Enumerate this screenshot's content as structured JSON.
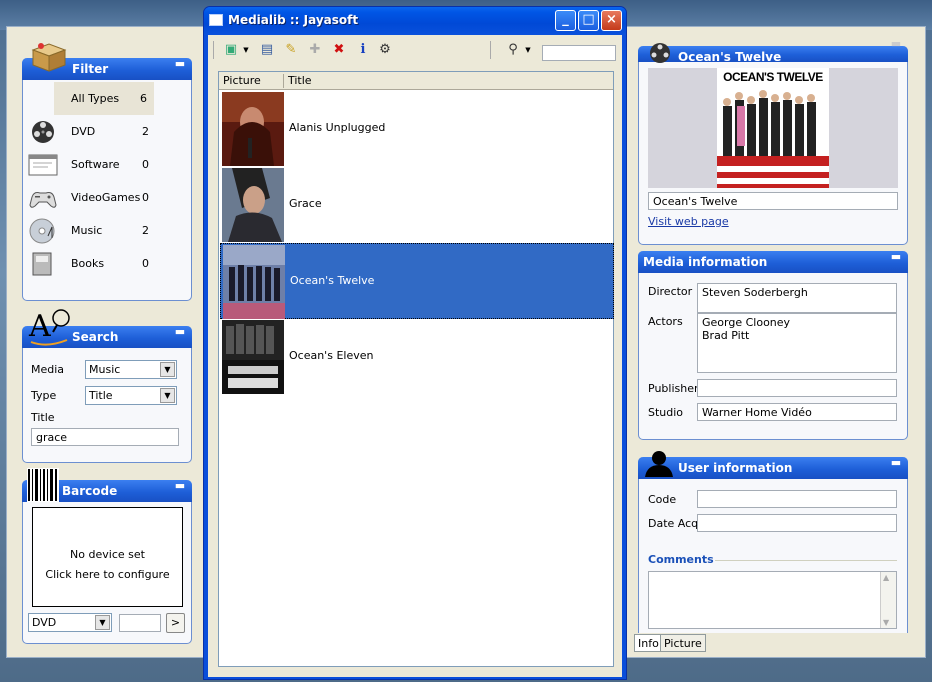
{
  "window": {
    "title": "Medialib :: Jayasoft"
  },
  "filter": {
    "title": "Filter",
    "items": [
      {
        "name": "All Types",
        "count": "6"
      },
      {
        "name": "DVD",
        "count": "2"
      },
      {
        "name": "Software",
        "count": "0"
      },
      {
        "name": "VideoGames",
        "count": "0"
      },
      {
        "name": "Music",
        "count": "2"
      },
      {
        "name": "Books",
        "count": "0"
      }
    ]
  },
  "search": {
    "title": "Search",
    "media_label": "Media",
    "media_value": "Music",
    "type_label": "Type",
    "type_value": "Title",
    "title_label": "Title",
    "title_value": "grace"
  },
  "barcode": {
    "title": "Barcode",
    "line1": "No device set",
    "line2": "Click here to configure",
    "device_value": "DVD",
    "code_value": "",
    "go_label": ">"
  },
  "list": {
    "col_picture": "Picture",
    "col_title": "Title",
    "rows": [
      {
        "title": "Alanis Unplugged"
      },
      {
        "title": "Grace"
      },
      {
        "title": "Ocean's Twelve"
      },
      {
        "title": "Ocean's Eleven"
      }
    ]
  },
  "preview": {
    "title": "Ocean's Twelve",
    "poster_text": "OCEAN'S TWELVE",
    "name_value": "Ocean's Twelve",
    "link": "Visit web page"
  },
  "media_info": {
    "title": "Media information",
    "director_label": "Director",
    "director_value": "Steven Soderbergh",
    "actors_label": "Actors",
    "actor1": "George Clooney",
    "actor2": "Brad Pitt",
    "publisher_label": "Publisher",
    "publisher_value": "",
    "studio_label": "Studio",
    "studio_value": "Warner Home Vidéo"
  },
  "user_info": {
    "title": "User information",
    "code_label": "Code",
    "code_value": "",
    "date_label": "Date Acq",
    "date_value": "",
    "comments_label": "Comments",
    "comments_value": ""
  },
  "tabs": {
    "info": "Info",
    "picture": "Picture"
  },
  "colors": {
    "pane_header": "#1e5fd8",
    "selection": "#316ac5",
    "titlebar": "#0055e5"
  }
}
